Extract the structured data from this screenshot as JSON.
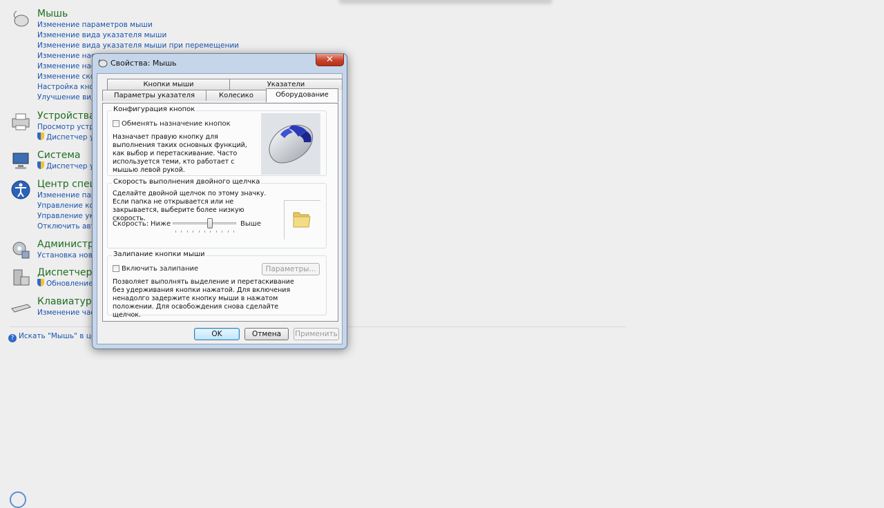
{
  "control_panel": {
    "groups": [
      {
        "key": "mouse",
        "title": "Мышь",
        "icon": "mouse-icon",
        "links": [
          {
            "text": "Изменение параметров мыши",
            "shield": false
          },
          {
            "text": "Изменение вида указателя мыши",
            "shield": false
          },
          {
            "text": "Изменение вида указателя мыши при перемещении",
            "shield": false
          },
          {
            "text": "Изменение наст",
            "shield": false
          },
          {
            "text": "Изменение наст",
            "shield": false
          },
          {
            "text": "Изменение скор",
            "shield": false
          },
          {
            "text": "Настройка кноп",
            "shield": false
          },
          {
            "text": "Улучшение вид",
            "shield": false
          }
        ]
      },
      {
        "key": "devices",
        "title": "Устройства и",
        "icon": "printer-icon",
        "links": [
          {
            "text": "Просмотр устро",
            "shield": false
          },
          {
            "text": "Диспетчер устр",
            "shield": true
          }
        ]
      },
      {
        "key": "system",
        "title": "Система",
        "icon": "computer-icon",
        "links": [
          {
            "text": "Диспетчер устр",
            "shield": true
          }
        ]
      },
      {
        "key": "ease",
        "title": "Центр специ",
        "icon": "accessibility-icon",
        "links": [
          {
            "text": "Изменение парам",
            "shield": false
          },
          {
            "text": "Управление ком",
            "shield": false
          },
          {
            "text": "Управление ука",
            "shield": false
          },
          {
            "text": "Отключить авто",
            "shield": false
          }
        ]
      },
      {
        "key": "admin",
        "title": "Администри",
        "icon": "admin-tools-icon",
        "links": [
          {
            "text": "Установка ново",
            "shield": false
          }
        ]
      },
      {
        "key": "devmgr",
        "title": "Диспетчер у",
        "icon": "device-manager-icon",
        "links": [
          {
            "text": "Обновление",
            "shield": true
          }
        ]
      },
      {
        "key": "keyboard",
        "title": "Клавиатура",
        "icon": "keyboard-icon",
        "links": [
          {
            "text": "Изменение част",
            "shield": false
          }
        ]
      }
    ],
    "search_help": "Искать \"Мышь\" в цен"
  },
  "dialog": {
    "title": "Свойства: Мышь",
    "close_glyph": "✕",
    "tabs_row1": [
      "Кнопки мыши",
      "Указатели"
    ],
    "tabs_row2": [
      "Параметры указателя",
      "Колесико",
      "Оборудование"
    ],
    "active_tab": "Оборудование",
    "button_config": {
      "title": "Конфигурация кнопок",
      "checkbox_label": "Обменять назначение кнопок",
      "checked": false,
      "description": "Назначает правую кнопку для выполнения таких основных функций, как выбор и перетаскивание. Часто используется теми, кто работает с мышью левой рукой."
    },
    "double_click": {
      "title": "Скорость выполнения двойного щелчка",
      "description": "Сделайте двойной щелчок по этому значку. Если папка не открывается или не закрывается, выберите более низкую скорость.",
      "speed_label": "Скорость:",
      "low_label": "Ниже",
      "high_label": "Выше",
      "slider_value": 0.6
    },
    "clicklock": {
      "title": "Залипание кнопки мыши",
      "checkbox_label": "Включить залипание",
      "checked": false,
      "settings_button": "Параметры...",
      "description": "Позволяет выполнять выделение и перетаскивание без удерживания кнопки нажатой. Для включения ненадолго задержите кнопку мыши в нажатом положении. Для освобождения снова сделайте щелчок."
    },
    "buttons": {
      "ok": "OK",
      "cancel": "Отмена",
      "apply": "Применить"
    }
  }
}
